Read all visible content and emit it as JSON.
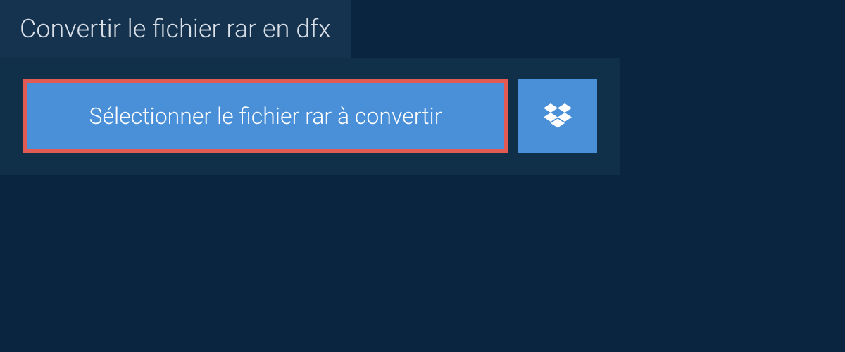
{
  "header": {
    "title": "Convertir le fichier rar en dfx"
  },
  "actions": {
    "select_file_label": "Sélectionner le fichier rar à convertir"
  },
  "colors": {
    "page_bg": "#0a2540",
    "panel_bg": "#10304a",
    "tab_bg": "#15334f",
    "button_bg": "#4a90d9",
    "highlight_border": "#e15b52",
    "text_light": "#d8dfe6",
    "text_white": "#ffffff"
  }
}
